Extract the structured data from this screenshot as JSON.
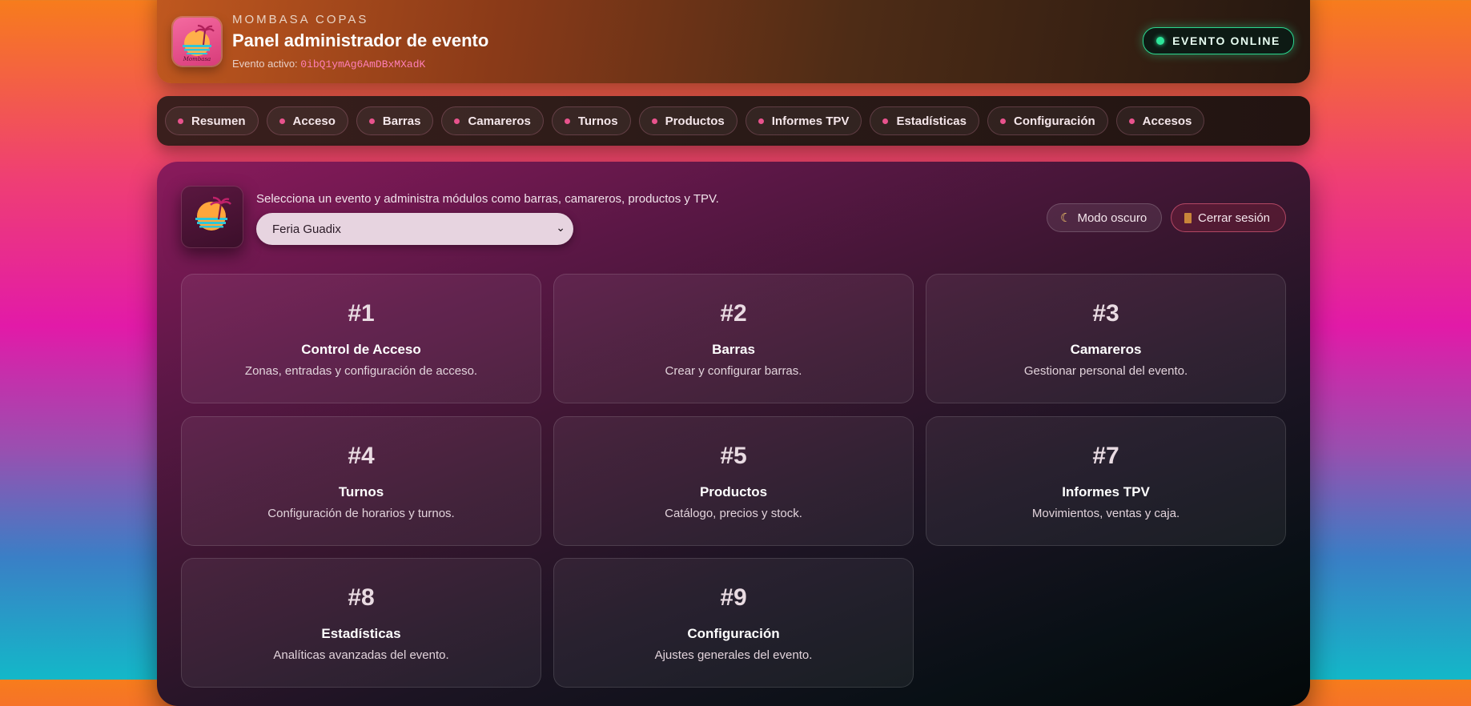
{
  "header": {
    "brand": "MOMBASA COPAS",
    "title": "Panel administrador de evento",
    "active_label": "Evento activo:",
    "active_id": "0ibQ1ymAg6AmDBxMXadK",
    "status": "EVENTO ONLINE",
    "logo_icon": "mombasa-sunset-logo",
    "logo_text": "Mombasa"
  },
  "nav": {
    "items": [
      {
        "label": "Resumen"
      },
      {
        "label": "Acceso"
      },
      {
        "label": "Barras"
      },
      {
        "label": "Camareros"
      },
      {
        "label": "Turnos"
      },
      {
        "label": "Productos"
      },
      {
        "label": "Informes TPV"
      },
      {
        "label": "Estadísticas"
      },
      {
        "label": "Configuración"
      },
      {
        "label": "Accesos"
      }
    ]
  },
  "main": {
    "intro": "Selecciona un evento y administra módulos como barras, camareros, productos y TPV.",
    "selected_event": "Feria Guadix",
    "dark_mode_label": "Modo oscuro",
    "logout_label": "Cerrar sesión",
    "modules": [
      {
        "num": "#1",
        "title": "Control de Acceso",
        "desc": "Zonas, entradas y configuración de acceso."
      },
      {
        "num": "#2",
        "title": "Barras",
        "desc": "Crear y configurar barras."
      },
      {
        "num": "#3",
        "title": "Camareros",
        "desc": "Gestionar personal del evento."
      },
      {
        "num": "#4",
        "title": "Turnos",
        "desc": "Configuración de horarios y turnos."
      },
      {
        "num": "#5",
        "title": "Productos",
        "desc": "Catálogo, precios y stock."
      },
      {
        "num": "#7",
        "title": "Informes TPV",
        "desc": "Movimientos, ventas y caja."
      },
      {
        "num": "#8",
        "title": "Estadísticas",
        "desc": "Analíticas avanzadas del evento."
      },
      {
        "num": "#9",
        "title": "Configuración",
        "desc": "Ajustes generales del evento."
      }
    ]
  },
  "colors": {
    "accent": "#e8538d",
    "online": "#2ee59a",
    "logout_border": "#ff6e8c"
  }
}
